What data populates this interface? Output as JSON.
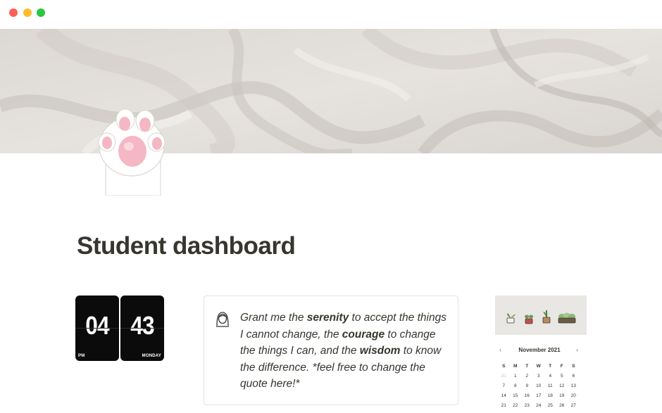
{
  "page": {
    "title": "Student dashboard"
  },
  "clock": {
    "hours": "04",
    "minutes": "43",
    "meridiem": "PM",
    "weekday": "MONDAY"
  },
  "quote": {
    "parts": [
      {
        "text": "Grant me the ",
        "bold": false
      },
      {
        "text": "serenity",
        "bold": true
      },
      {
        "text": " to accept the things I cannot change, the ",
        "bold": false
      },
      {
        "text": "courage",
        "bold": true
      },
      {
        "text": " to change the things I can, and the ",
        "bold": false
      },
      {
        "text": "wisdom",
        "bold": true
      },
      {
        "text": " to know the difference. *feel free to change the quote here!*",
        "bold": false
      }
    ]
  },
  "calendar": {
    "month_label": "November 2021",
    "prev": "‹",
    "next": "›",
    "weekdays": [
      "S",
      "M",
      "T",
      "W",
      "T",
      "F",
      "S"
    ],
    "weeks": [
      [
        "31",
        "1",
        "2",
        "3",
        "4",
        "5",
        "6"
      ],
      [
        "7",
        "8",
        "9",
        "10",
        "11",
        "12",
        "13"
      ],
      [
        "14",
        "15",
        "16",
        "17",
        "18",
        "19",
        "20"
      ],
      [
        "21",
        "22",
        "23",
        "24",
        "25",
        "26",
        "27"
      ]
    ],
    "muted_days": [
      "31"
    ]
  },
  "colors": {
    "window_close": "#ff5f57",
    "window_minimize": "#febc2e",
    "window_zoom": "#28c840",
    "text": "#37352f",
    "clock_card": "#0b0b0b"
  },
  "icons": {
    "page_icon": "cat-paw-icon",
    "callout_icon": "woman-face-icon",
    "plants": [
      "potted-plant-icon",
      "potted-plant-icon",
      "potted-plant-icon",
      "planter-box-icon"
    ]
  }
}
